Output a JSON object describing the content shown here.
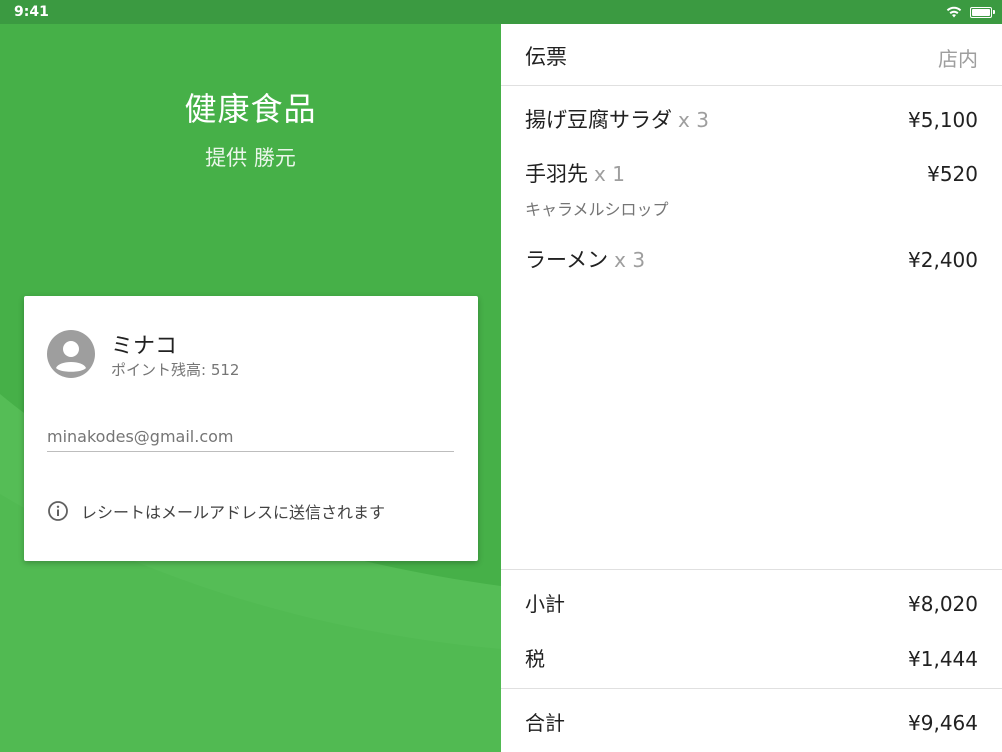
{
  "status_bar": {
    "time": "9:41"
  },
  "store": {
    "name": "健康食品",
    "cashier": "提供 勝元"
  },
  "customer": {
    "name": "ミナコ",
    "points": "ポイント残高: 512",
    "email": "minakodes@gmail.com",
    "notice": "レシートはメールアドレスに送信されます"
  },
  "ticket": {
    "title": "伝票",
    "dining_mode": "店内",
    "items": [
      {
        "name": "揚げ豆腐サラダ",
        "qty": "x 3",
        "price": "¥5,100",
        "modifier": ""
      },
      {
        "name": "手羽先",
        "qty": "x 1",
        "price": "¥520",
        "modifier": "キャラメルシロップ"
      },
      {
        "name": "ラーメン",
        "qty": "x 3",
        "price": "¥2,400",
        "modifier": ""
      }
    ],
    "subtotal_label": "小計",
    "subtotal": "¥8,020",
    "tax_label": "税",
    "tax": "¥1,444",
    "total_label": "合計",
    "total": "¥9,464"
  },
  "colors": {
    "primary_green": "#46b048",
    "status_green": "#3b9a41",
    "wave_green": "#5cc25c"
  },
  "icons": [
    "wifi-icon",
    "battery-icon",
    "avatar-icon",
    "info-icon"
  ]
}
